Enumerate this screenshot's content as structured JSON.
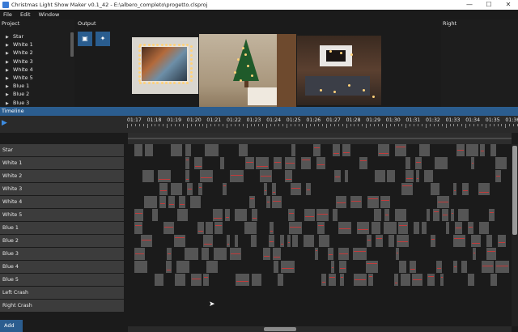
{
  "window": {
    "title": "Christmas Light Show Maker v0.1_42 - E:\\albero_completo\\progetto.clsproj",
    "minimize": "—",
    "maximize": "☐",
    "close": "✕"
  },
  "menu": {
    "file": "File",
    "edit": "Edit",
    "window": "Window"
  },
  "panels": {
    "project": "Project",
    "output": "Output",
    "right": "Right"
  },
  "project_items": [
    "Star",
    "White 1",
    "White 2",
    "White 3",
    "White 4",
    "White 5",
    "Blue 1",
    "Blue 2",
    "Blue 3"
  ],
  "output_tools": {
    "image_icon": "image-icon",
    "light_icon": "light-bulb-icon"
  },
  "timeline": {
    "title": "Timeline",
    "ticks": [
      "01:17",
      "01:18",
      "01:19",
      "01:20",
      "01:21",
      "01:22",
      "01:23",
      "01:24",
      "01:25",
      "01:26",
      "01:27",
      "01:28",
      "01:29",
      "01:30",
      "01:31",
      "01:32",
      "01:33",
      "01:34",
      "01:35",
      "01:36"
    ],
    "lanes": [
      "Star",
      "White 1",
      "White 2",
      "White 3",
      "White 4",
      "White 5",
      "Blue 1",
      "Blue 2",
      "Blue 3",
      "Blue 4",
      "Blue 5",
      "Left Crash",
      "Right Crash"
    ],
    "add_label": "Add"
  },
  "colors": {
    "accent": "#2b5d8f",
    "cell": "#555555",
    "red_line": "#c23b3b",
    "led": "#ffd27a"
  }
}
